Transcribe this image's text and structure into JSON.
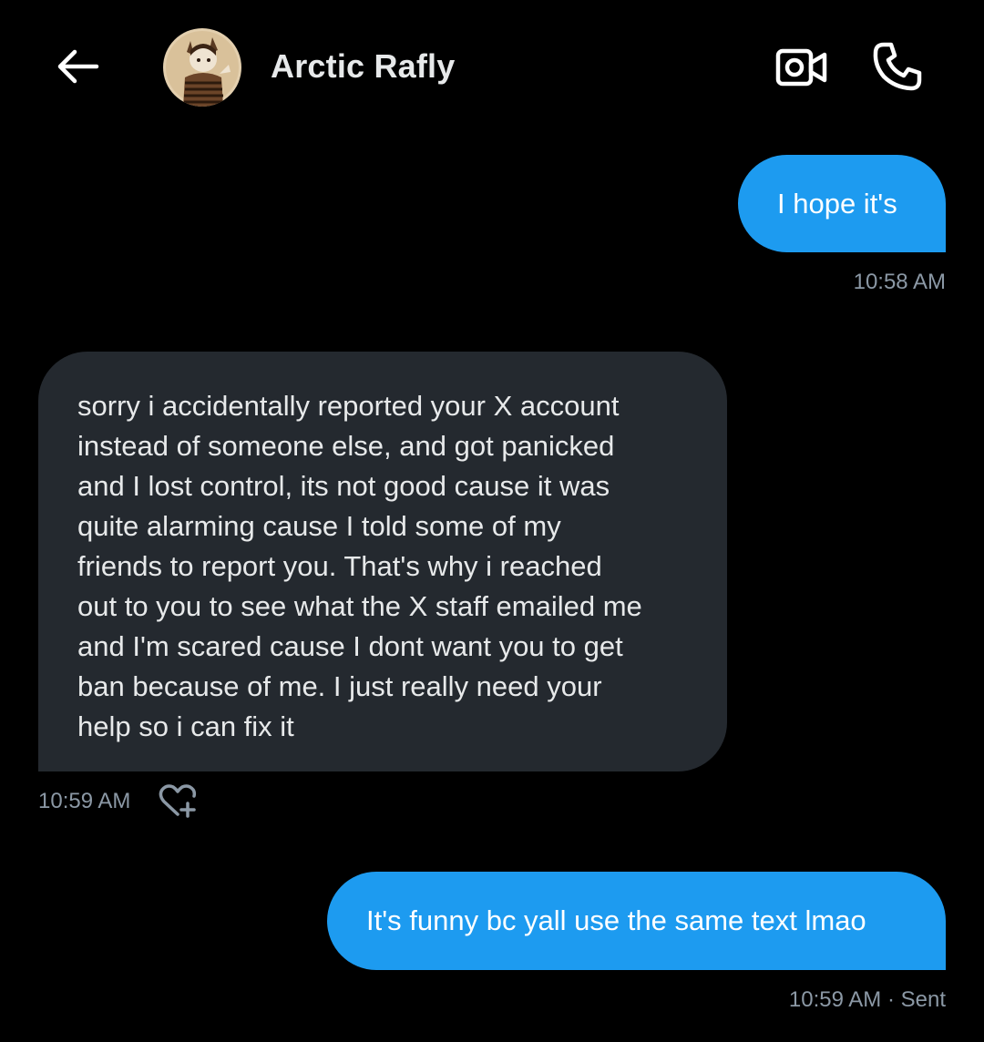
{
  "header": {
    "contact_name": "Arctic Rafly",
    "back_icon": "arrow-left-icon",
    "video_icon": "video-camera-icon",
    "call_icon": "phone-icon"
  },
  "messages": [
    {
      "direction": "sent",
      "text": "I hope it's",
      "timestamp": "10:58 AM"
    },
    {
      "direction": "received",
      "text": "sorry i accidentally reported your X account\ninstead of someone else, and got panicked\nand I lost control, its not good cause it was\nquite alarming cause I told some of my\nfriends to report you. That's why i reached\nout to you to see what the X staff emailed me\nand I'm scared cause I dont want you to get\nban because of me. I just really need your\nhelp so i can fix it",
      "timestamp": "10:59 AM",
      "reaction_icon": "heart-plus-icon"
    },
    {
      "direction": "sent",
      "text": "It's funny bc yall use the same text lmao",
      "timestamp": "10:59 AM · Sent"
    }
  ],
  "colors": {
    "background": "#000000",
    "sent_bubble": "#1d9bf0",
    "received_bubble": "#24292f",
    "text_primary": "#e7e9ea",
    "text_secondary": "#8b98a5"
  }
}
